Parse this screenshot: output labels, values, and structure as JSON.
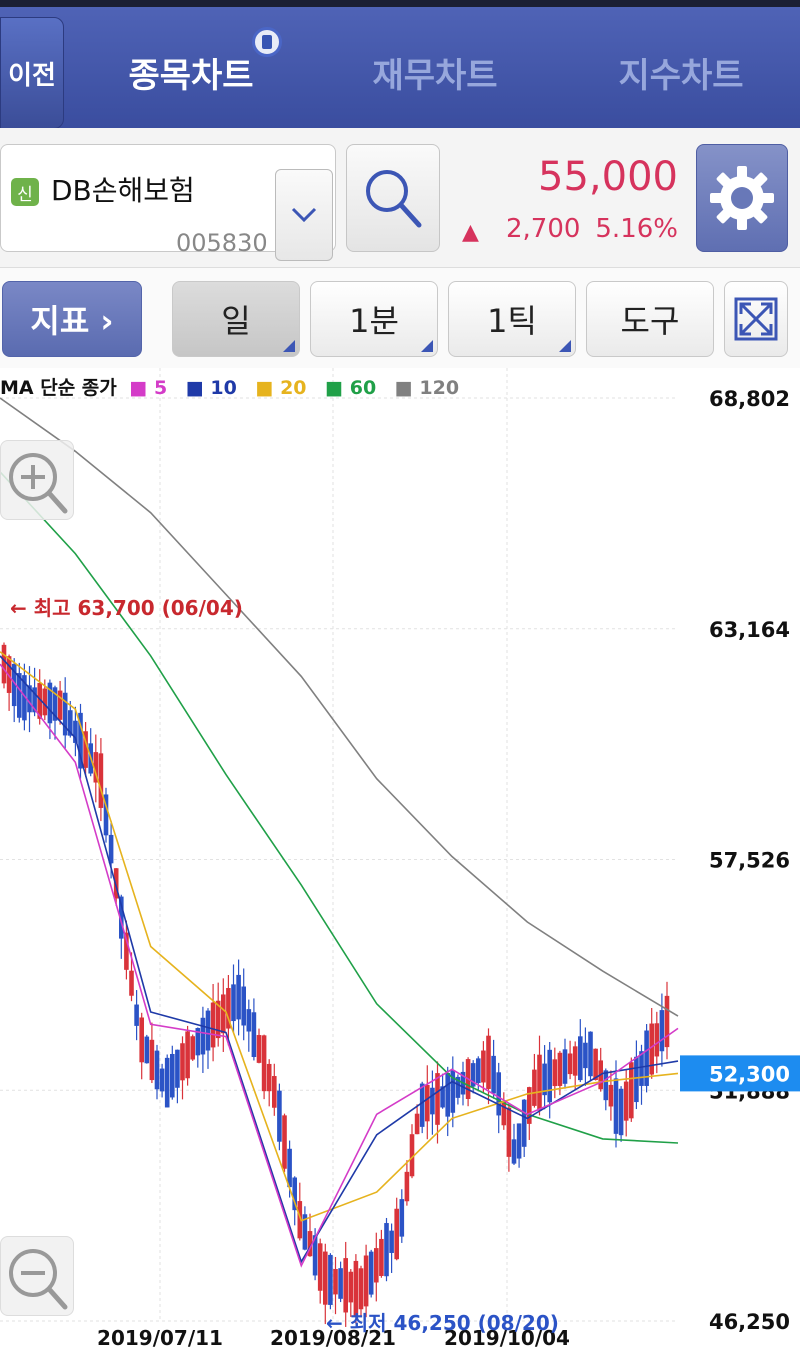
{
  "header": {
    "back_label": "이전",
    "tabs": [
      {
        "label": "종목차트",
        "active": true
      },
      {
        "label": "재무차트",
        "active": false
      },
      {
        "label": "지수차트",
        "active": false
      }
    ]
  },
  "stock": {
    "credit_badge": "신",
    "name": "DB손해보험",
    "code": "005830",
    "price": "55,000",
    "change_arrow": "▲",
    "change": "2,700",
    "change_pct": "5.16%"
  },
  "toolbar": {
    "indicator_label": "지표 ›",
    "day_label": "일",
    "minute_label": "1분",
    "tick_label": "1틱",
    "tool_label": "도구"
  },
  "colors": {
    "up": "#d9333a",
    "down": "#2b53c6",
    "ma5": "#d43cc8",
    "ma10": "#1f3aa8",
    "ma20": "#e6b31e",
    "ma60": "#20a048",
    "ma120": "#808080"
  },
  "chart_data": {
    "type": "candlestick",
    "title": "MA 단순 종가",
    "legend": [
      {
        "name": "5",
        "color": "#d43cc8"
      },
      {
        "name": "10",
        "color": "#1f3aa8"
      },
      {
        "name": "20",
        "color": "#e6b31e"
      },
      {
        "name": "60",
        "color": "#20a048"
      },
      {
        "name": "120",
        "color": "#808080"
      }
    ],
    "y_ticks": [
      "68,802",
      "63,164",
      "57,526",
      "51,888",
      "46,250"
    ],
    "ylim": [
      46250,
      68802
    ],
    "x_ticks": [
      "2019/07/11",
      "2019/08/21",
      "2019/10/04"
    ],
    "current_price_label": "52,300",
    "current_price": 52300,
    "high_label": "← 최고 63,700 (06/04)",
    "low_label": "← 최저 46,250 (08/20)",
    "ma120": [
      68802,
      67500,
      66000,
      64000,
      62000,
      59500,
      57600,
      56000,
      54800,
      53700
    ],
    "ma60": [
      67000,
      65000,
      62500,
      59600,
      56900,
      54000,
      52200,
      51300,
      50700,
      50600
    ],
    "ma20": [
      62600,
      61200,
      55400,
      53800,
      48700,
      49400,
      51200,
      51800,
      52100,
      52300
    ],
    "ma10": [
      62500,
      60500,
      53800,
      53300,
      47700,
      50800,
      52100,
      51200,
      52300,
      52600
    ],
    "ma5": [
      62300,
      59900,
      53500,
      53200,
      47600,
      51300,
      52400,
      51300,
      52100,
      53400
    ]
  }
}
